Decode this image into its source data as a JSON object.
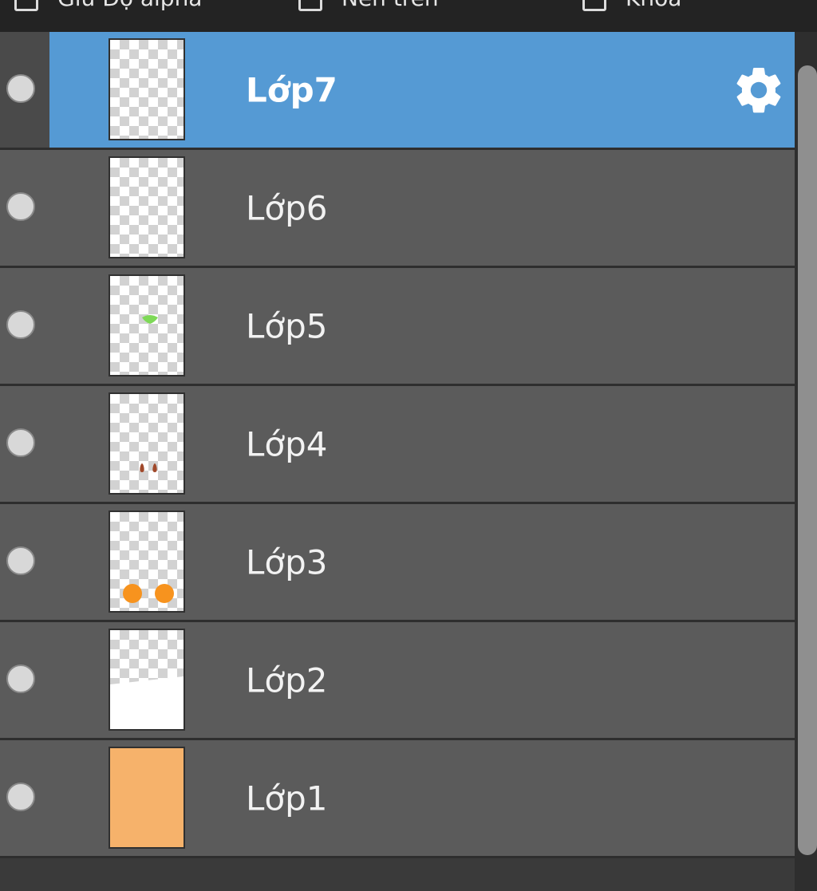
{
  "top_options": [
    {
      "label": "Giữ Độ alpha"
    },
    {
      "label": "Nền trên"
    },
    {
      "label": "Khóa"
    }
  ],
  "layers": [
    {
      "name": "Lớp7",
      "selected": true,
      "thumb": "empty"
    },
    {
      "name": "Lớp6",
      "selected": false,
      "thumb": "empty"
    },
    {
      "name": "Lớp5",
      "selected": false,
      "thumb": "green-mark"
    },
    {
      "name": "Lớp4",
      "selected": false,
      "thumb": "brown-drops"
    },
    {
      "name": "Lớp3",
      "selected": false,
      "thumb": "orange-dots"
    },
    {
      "name": "Lớp2",
      "selected": false,
      "thumb": "white-bottom"
    },
    {
      "name": "Lớp1",
      "selected": false,
      "thumb": "solid-orange"
    }
  ],
  "colors": {
    "selected_row": "#559ad4",
    "row": "#5b5b5b",
    "orange_fill": "#f6b26b",
    "orange_dot": "#f7931e",
    "green_mark": "#7ed957",
    "brown_mark": "#a0492b"
  },
  "icons": {
    "settings": "gear-icon",
    "visibility": "visibility-dot-icon"
  }
}
